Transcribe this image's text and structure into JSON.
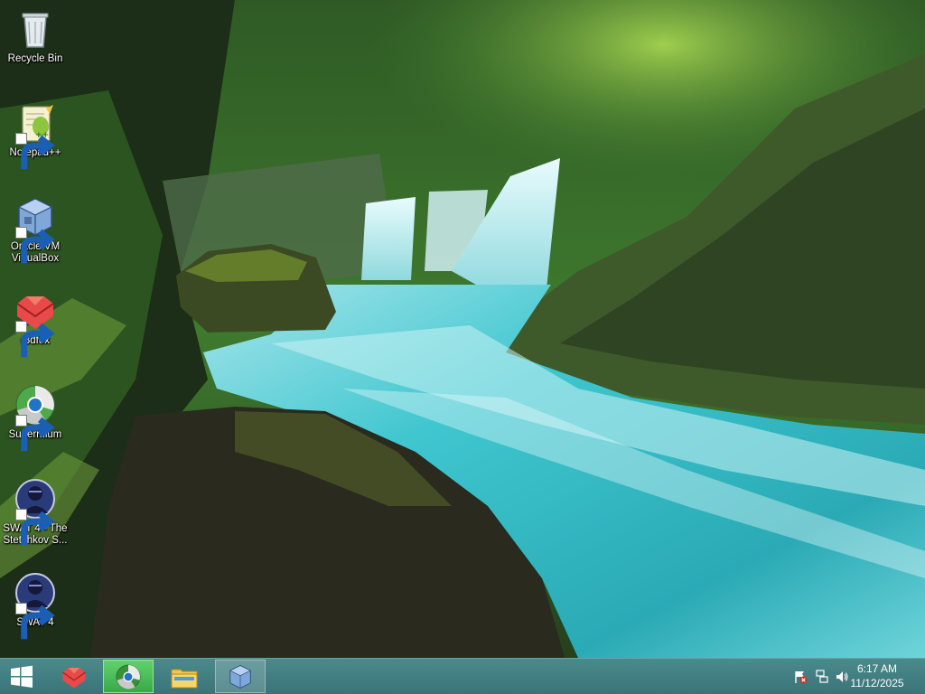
{
  "desktop": {
    "icons": [
      {
        "label": "Recycle Bin",
        "icon": "recycle-bin-icon",
        "shortcut": false
      },
      {
        "label": "Notepad++",
        "icon": "notepad-plus-plus-icon",
        "shortcut": true
      },
      {
        "label": "Oracle VM\nVirtualBox",
        "icon": "virtualbox-icon",
        "shortcut": true
      },
      {
        "label": "r3dfox",
        "icon": "r3dfox-icon",
        "shortcut": true
      },
      {
        "label": "Supermium",
        "icon": "supermium-icon",
        "shortcut": true
      },
      {
        "label": "SWAT 4 - The\nStetchkov S...",
        "icon": "swat4-icon",
        "shortcut": true
      },
      {
        "label": "SWAT 4",
        "icon": "swat4-icon",
        "shortcut": true
      }
    ]
  },
  "taskbar": {
    "start_icon": "windows-logo-icon",
    "pinned": [
      {
        "icon": "r3dfox-icon",
        "state": "normal"
      },
      {
        "icon": "supermium-icon",
        "state": "active-green"
      },
      {
        "icon": "file-explorer-icon",
        "state": "normal"
      },
      {
        "icon": "virtualbox-icon",
        "state": "active"
      }
    ],
    "tray": {
      "icons": [
        "action-center-flag-icon",
        "network-icon",
        "volume-icon"
      ],
      "time": "6:17 AM",
      "date": "11/12/2025"
    }
  },
  "colors": {
    "taskbar": "#3f7c80",
    "water": "#3fc6cf",
    "forest": "#2e5a2a"
  }
}
